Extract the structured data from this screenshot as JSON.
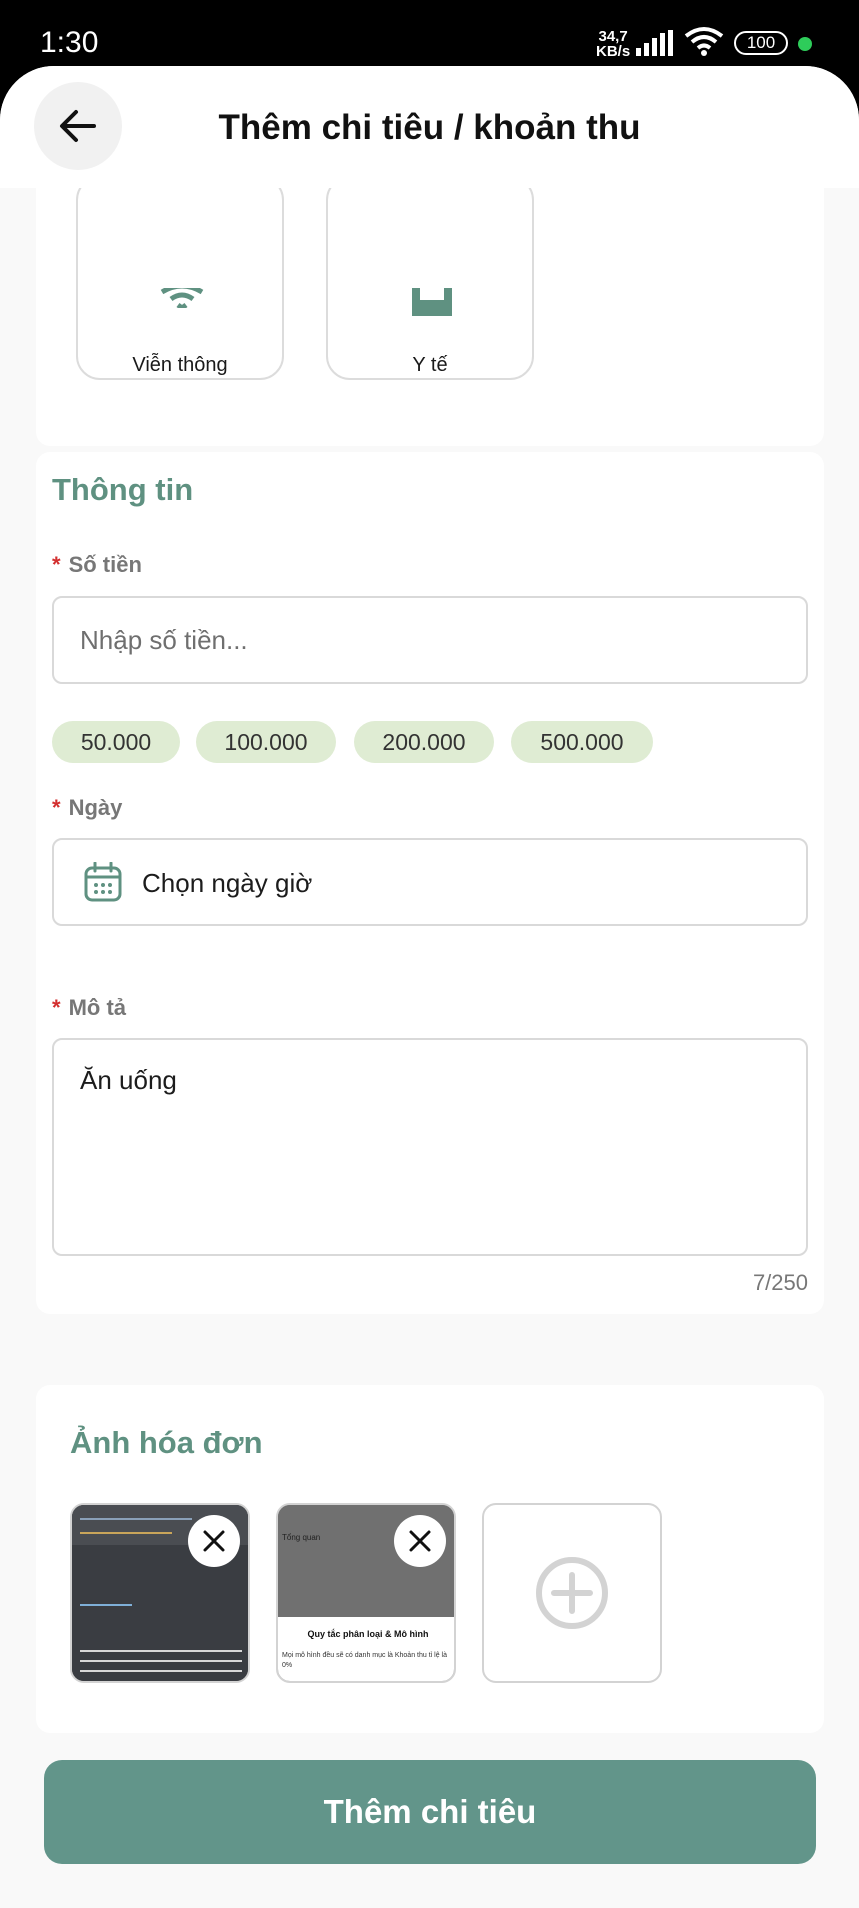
{
  "status_bar": {
    "time": "1:30",
    "net_speed_value": "34,7",
    "net_speed_unit": "KB/s",
    "battery": "100"
  },
  "header": {
    "title": "Thêm chi tiêu / khoản thu"
  },
  "categories": [
    {
      "label": "Viễn thông",
      "icon": "wifi-icon"
    },
    {
      "label": "Y tế",
      "icon": "medical-icon"
    }
  ],
  "info": {
    "section_title": "Thông tin",
    "required_mark": "*",
    "amount": {
      "label": "Số tiền",
      "placeholder": "Nhập số tiền...",
      "quick_amounts": [
        "50.000",
        "100.000",
        "200.000",
        "500.000"
      ]
    },
    "date": {
      "label": "Ngày",
      "placeholder": "Chọn ngày giờ"
    },
    "description": {
      "label": "Mô tả",
      "value": "Ăn uống",
      "counter": "7/250"
    }
  },
  "receipt": {
    "section_title": "Ảnh hóa đơn",
    "thumb2_heading": "Tổng quan",
    "thumb2_caption": "Quy tắc phân loại & Mô hình",
    "thumb2_subtext": "Mọi mô hình đều sẽ có danh mục là Khoản thu tỉ lệ là 0%"
  },
  "submit_label": "Thêm chi tiêu",
  "colors": {
    "primary": "#62958a",
    "section_title": "#5f9181",
    "chip_bg": "#dfecd3",
    "required": "#d32f2f"
  }
}
